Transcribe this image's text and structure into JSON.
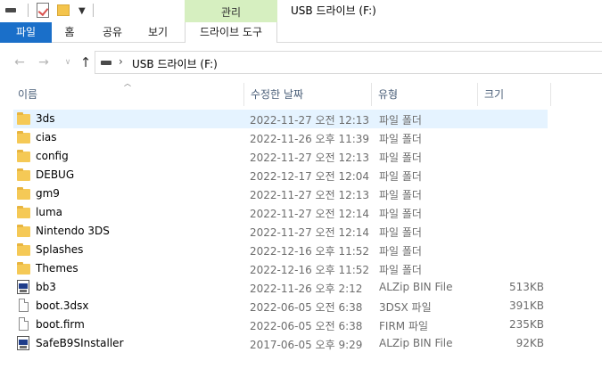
{
  "window": {
    "title": "USB 드라이브 (F:)",
    "context_tab_group": "관리"
  },
  "ribbon": {
    "tabs": [
      "파일",
      "홈",
      "공유",
      "보기",
      "드라이브 도구"
    ]
  },
  "address_bar": {
    "path": "USB 드라이브 (F:)"
  },
  "columns": {
    "name": "이름",
    "date": "수정한 날짜",
    "type": "유형",
    "size": "크기"
  },
  "files": [
    {
      "name": "3ds",
      "date": "2022-11-27 오전 12:13",
      "type": "파일 폴더",
      "size": "",
      "icon": "folder-icon",
      "selected": true
    },
    {
      "name": "cias",
      "date": "2022-11-26 오후 11:39",
      "type": "파일 폴더",
      "size": "",
      "icon": "folder-icon"
    },
    {
      "name": "config",
      "date": "2022-11-27 오전 12:13",
      "type": "파일 폴더",
      "size": "",
      "icon": "folder-icon"
    },
    {
      "name": "DEBUG",
      "date": "2022-12-17 오전 12:04",
      "type": "파일 폴더",
      "size": "",
      "icon": "folder-icon"
    },
    {
      "name": "gm9",
      "date": "2022-11-27 오전 12:13",
      "type": "파일 폴더",
      "size": "",
      "icon": "folder-icon"
    },
    {
      "name": "luma",
      "date": "2022-11-27 오전 12:14",
      "type": "파일 폴더",
      "size": "",
      "icon": "folder-icon"
    },
    {
      "name": "Nintendo 3DS",
      "date": "2022-11-27 오전 12:14",
      "type": "파일 폴더",
      "size": "",
      "icon": "folder-icon"
    },
    {
      "name": "Splashes",
      "date": "2022-12-16 오후 11:52",
      "type": "파일 폴더",
      "size": "",
      "icon": "folder-icon"
    },
    {
      "name": "Themes",
      "date": "2022-12-16 오후 11:52",
      "type": "파일 폴더",
      "size": "",
      "icon": "folder-icon"
    },
    {
      "name": "bb3",
      "date": "2022-11-26 오후 2:12",
      "type": "ALZip BIN File",
      "size": "513KB",
      "icon": "bin-file-icon"
    },
    {
      "name": "boot.3dsx",
      "date": "2022-06-05 오전 6:38",
      "type": "3DSX 파일",
      "size": "391KB",
      "icon": "file-icon"
    },
    {
      "name": "boot.firm",
      "date": "2022-06-05 오전 6:38",
      "type": "FIRM 파일",
      "size": "235KB",
      "icon": "file-icon"
    },
    {
      "name": "SafeB9SInstaller",
      "date": "2017-06-05 오후 9:29",
      "type": "ALZip BIN File",
      "size": "92KB",
      "icon": "bin-file-icon"
    }
  ]
}
